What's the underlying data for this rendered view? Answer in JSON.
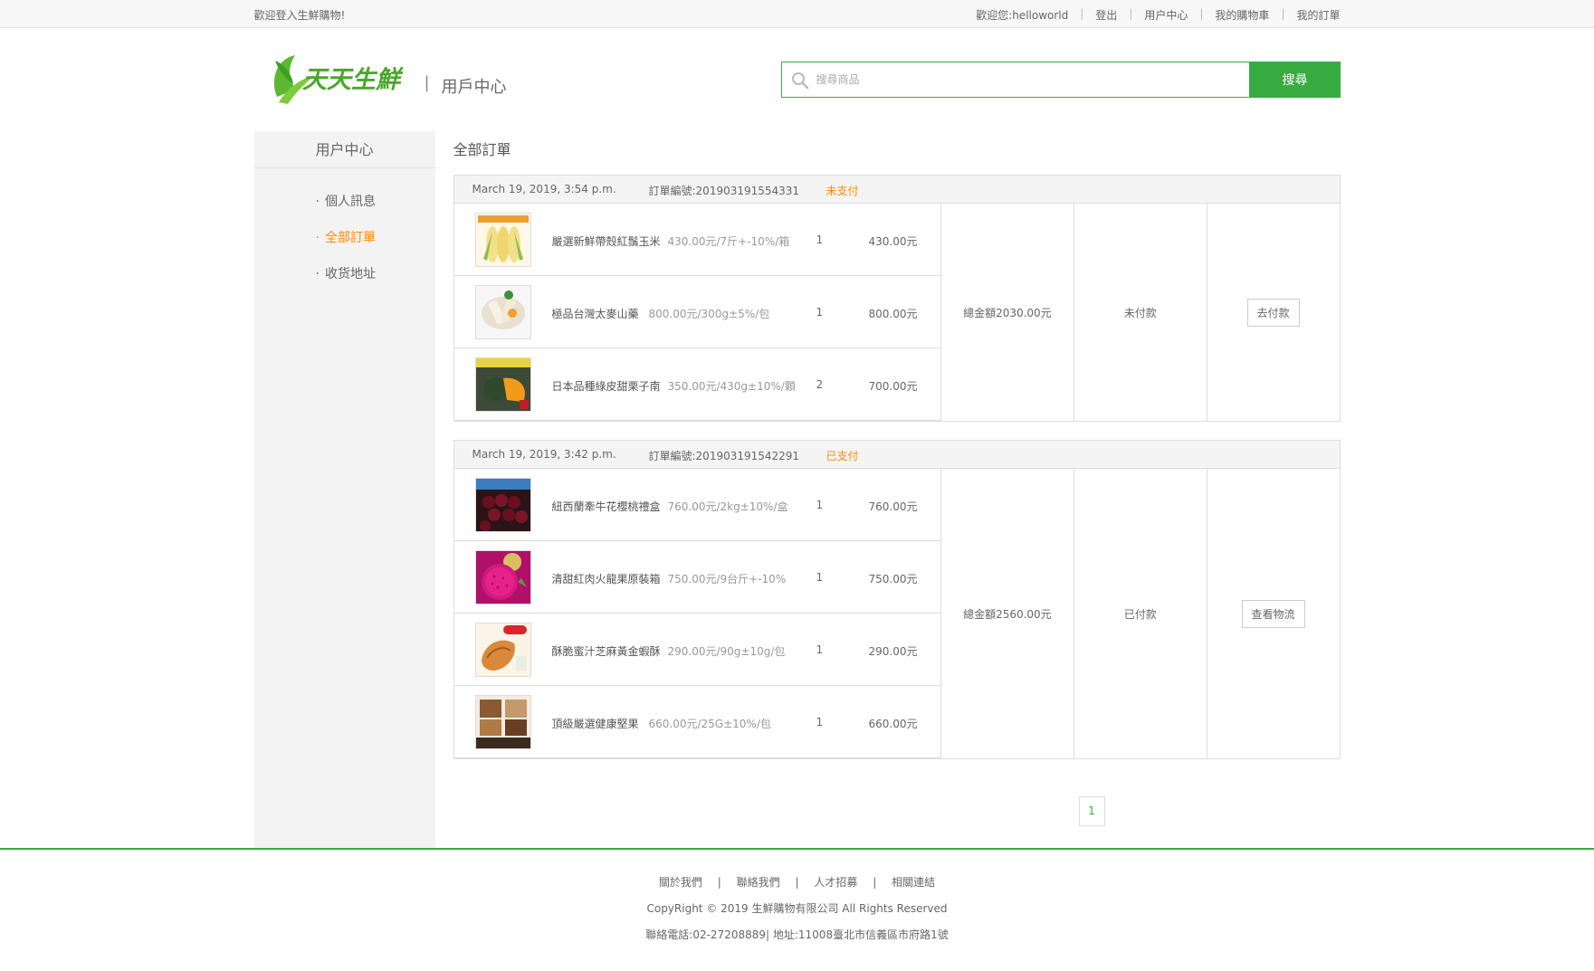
{
  "topbar": {
    "welcome": "歡迎登入生鮮購物!",
    "greeting": "歡迎您:",
    "username": "helloworld",
    "logout": "登出",
    "user_center": "用户中心",
    "cart": "我的購物車",
    "orders": "我的訂單"
  },
  "header": {
    "logo_text": "天天生鮮",
    "separator": "|",
    "title": "用戶中心",
    "search_placeholder": "搜尋商品",
    "search_button": "搜尋"
  },
  "sidebar": {
    "title": "用户中心",
    "items": [
      {
        "label": "個人訊息",
        "active": false
      },
      {
        "label": "全部訂單",
        "active": true
      },
      {
        "label": "收货地址",
        "active": false
      }
    ]
  },
  "content": {
    "title": "全部訂單"
  },
  "orders": [
    {
      "date": "March 19, 2019, 3:54 p.m.",
      "number_label": "訂單編號:",
      "number": "201903191554331",
      "status": "未支付",
      "total": "總金額2030.00元",
      "pay_status": "未付款",
      "action": "去付款",
      "items": [
        {
          "name": "嚴選新鮮帶殼紅鬚玉米",
          "price": "430.00元/7斤+-10%/箱",
          "qty": "1",
          "subtotal": "430.00元",
          "thumb": "corn"
        },
        {
          "name": "極品台灣太麥山藥",
          "price": "800.00元/300g±5%/包",
          "qty": "1",
          "subtotal": "800.00元",
          "thumb": "yam"
        },
        {
          "name": "日本品種綠皮甜栗子南",
          "price": "350.00元/430g±10%/顆",
          "qty": "2",
          "subtotal": "700.00元",
          "thumb": "pumpkin"
        }
      ]
    },
    {
      "date": "March 19, 2019, 3:42 p.m.",
      "number_label": "訂單編號:",
      "number": "201903191542291",
      "status": "已支付",
      "total": "總金額2560.00元",
      "pay_status": "已付款",
      "action": "查看物流",
      "items": [
        {
          "name": "紐西蘭牽牛花櫻桃禮盒",
          "price": "760.00元/2kg±10%/盒",
          "qty": "1",
          "subtotal": "760.00元",
          "thumb": "cherry"
        },
        {
          "name": "清甜紅肉火龍果原裝箱",
          "price": "750.00元/9台斤+-10%",
          "qty": "1",
          "subtotal": "750.00元",
          "thumb": "dragonfruit"
        },
        {
          "name": "酥脆蜜汁芝麻黃金蝦酥",
          "price": "290.00元/90g±10g/包",
          "qty": "1",
          "subtotal": "290.00元",
          "thumb": "shrimp"
        },
        {
          "name": "頂級嚴選健康堅果",
          "price": "660.00元/25G±10%/包",
          "qty": "1",
          "subtotal": "660.00元",
          "thumb": "nuts"
        }
      ]
    }
  ],
  "pager": {
    "current": "1"
  },
  "footer": {
    "links": [
      "關於我們",
      "聯絡我們",
      "人才招募",
      "相關連結"
    ],
    "link_separator": "|",
    "copyright": "CopyRight © 2019 生鮮購物有限公司 All Rights Reserved",
    "contact": "聯絡電話:02-27208889|    地址:11008臺北市信義區市府路1號"
  },
  "colors": {
    "brand_green": "#37ab40",
    "accent_orange": "#ff8800"
  }
}
